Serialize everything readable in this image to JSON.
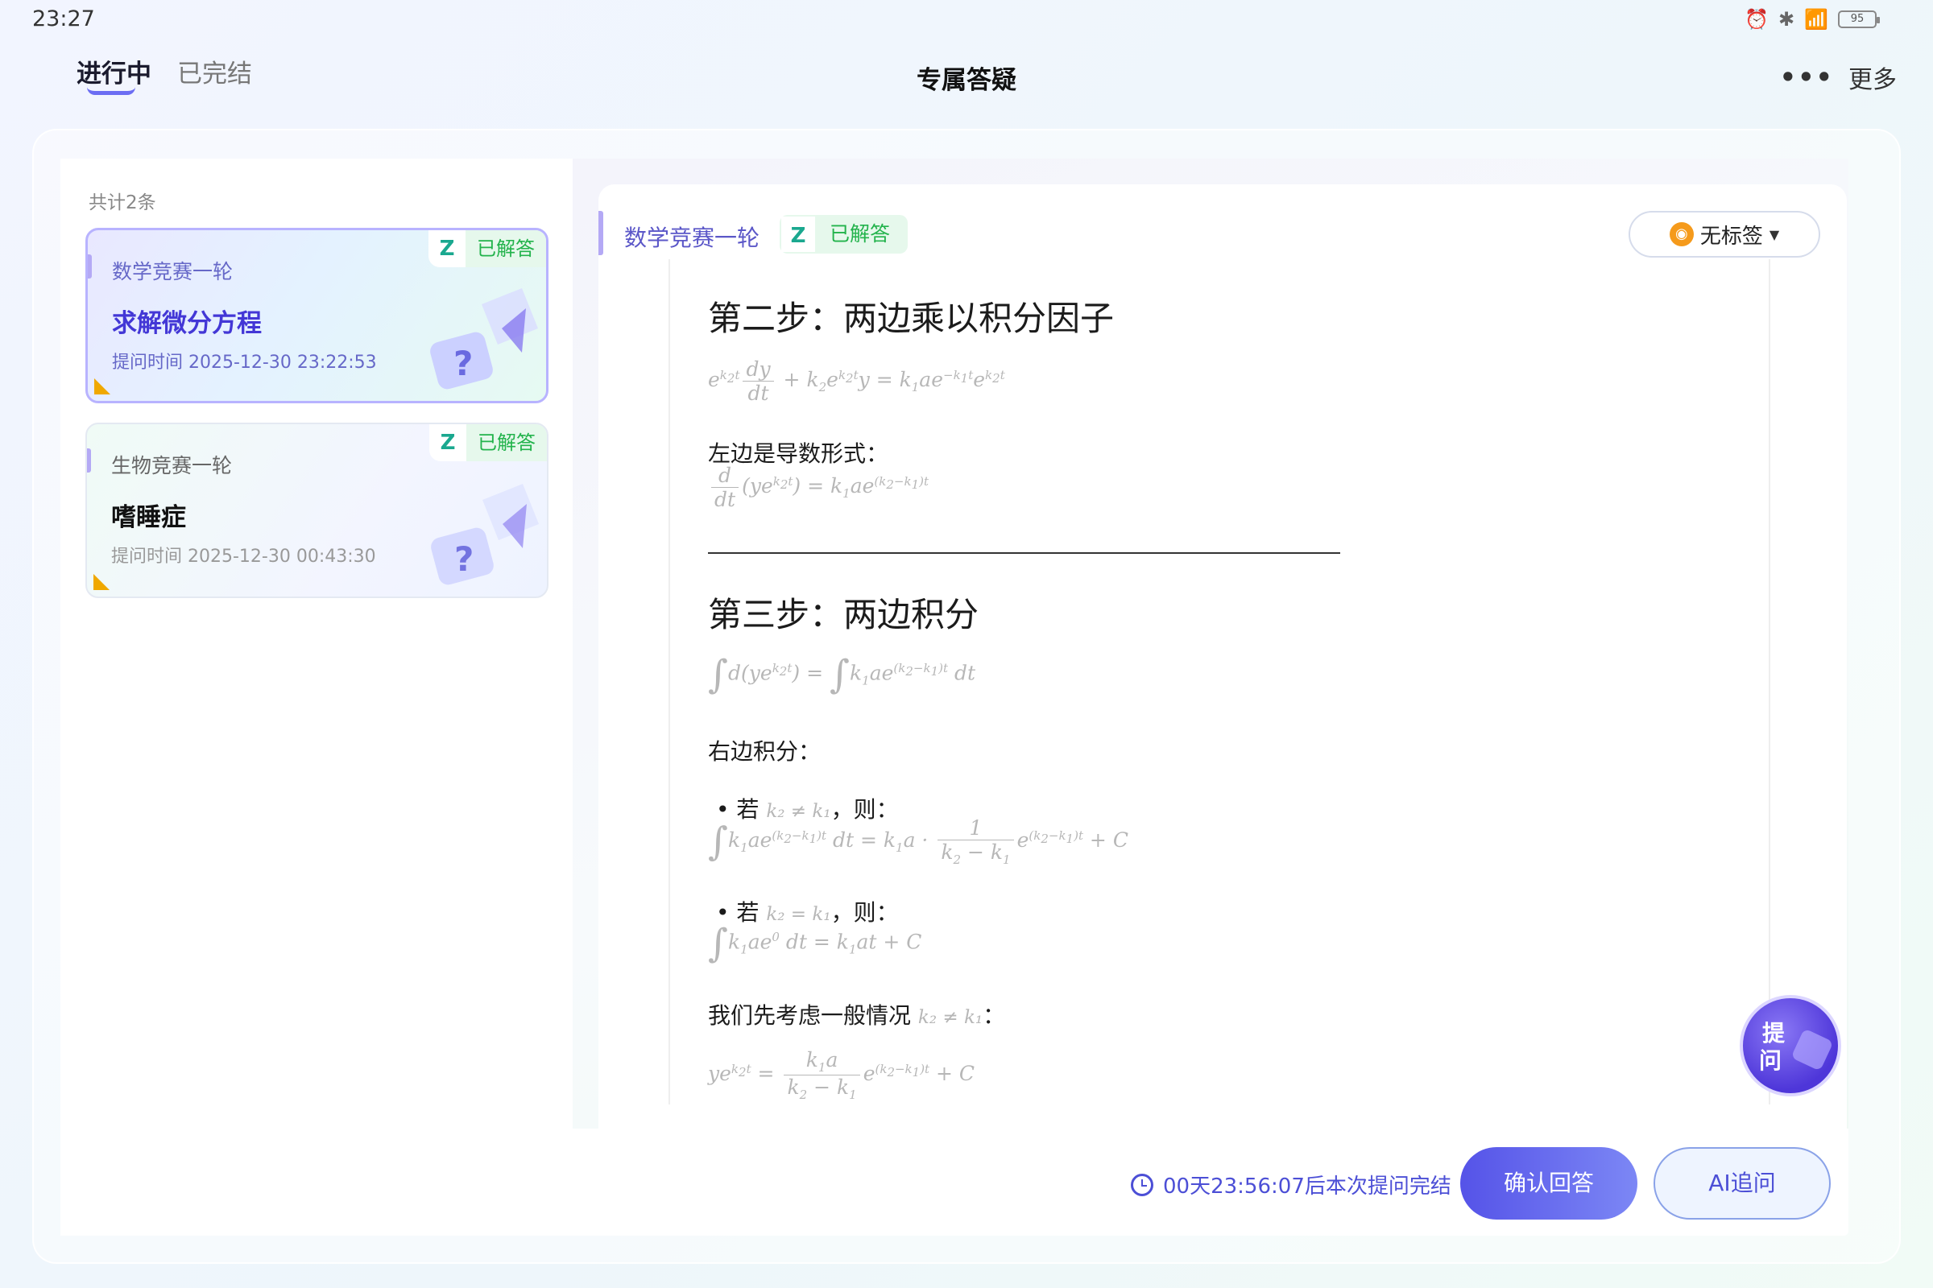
{
  "status_bar": {
    "time": "23:27",
    "battery": "95"
  },
  "header": {
    "tabs": [
      {
        "label": "进行中"
      },
      {
        "label": "已完结"
      }
    ],
    "title": "专属答疑",
    "more_label": "更多"
  },
  "list": {
    "count": "共计2条",
    "items": [
      {
        "subject": "数学竞赛一轮",
        "title": "求解微分方程",
        "time": "提问时间 2025-12-30 23:22:53",
        "badge": "已解答"
      },
      {
        "subject": "生物竞赛一轮",
        "title": "嗜睡症",
        "time": "提问时间 2025-12-30 00:43:30",
        "badge": "已解答"
      }
    ]
  },
  "detail": {
    "subject": "数学竞赛一轮",
    "badge": "已解答",
    "tag_label": "无标签",
    "step2_heading": "第二步：两边乘以积分因子",
    "left_is_derivative": "左边是导数形式：",
    "step3_heading": "第三步：两边积分",
    "right_integral": "右边积分：",
    "case1_prefix": "若",
    "case1_cond": "k₂ ≠ k₁",
    "case1_suffix": "，则：",
    "case2_prefix": "若",
    "case2_cond": "k₂ = k₁",
    "case2_suffix": "，则：",
    "consider_text": "我们先考虑一般情况",
    "consider_cond": "k₂ ≠ k₁",
    "consider_suffix": "："
  },
  "footer": {
    "countdown": "00天23:56:07后本次提问完结",
    "confirm_label": "确认回答",
    "ai_label": "AI追问"
  },
  "fab": {
    "line1": "提",
    "line2": "问"
  },
  "colors": {
    "accent": "#4c4fd6",
    "success": "#23b34c",
    "warning": "#f0a800"
  }
}
